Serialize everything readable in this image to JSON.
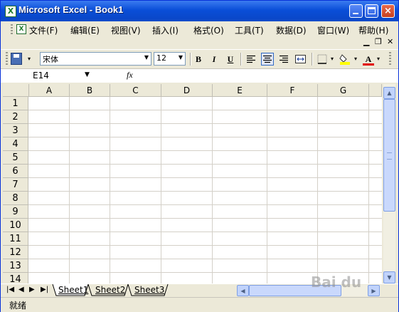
{
  "window": {
    "title": "Microsoft Excel - Book1",
    "app_icon": "excel-icon"
  },
  "menubar": {
    "items": [
      "文件(F)",
      "编辑(E)",
      "视图(V)",
      "插入(I)",
      "格式(O)",
      "工具(T)",
      "数据(D)",
      "窗口(W)",
      "帮助(H)"
    ]
  },
  "toolbar": {
    "font_name": "宋体",
    "font_size": "12",
    "bold": "B",
    "italic": "I",
    "underline": "U",
    "font_color_letter": "A"
  },
  "formula_bar": {
    "cell_ref": "E14",
    "fx": "fx",
    "formula": ""
  },
  "grid": {
    "columns": [
      "A",
      "B",
      "C",
      "D",
      "E",
      "F",
      "G"
    ],
    "rows": [
      "1",
      "2",
      "3",
      "4",
      "5",
      "6",
      "7",
      "8",
      "9",
      "10",
      "11",
      "12",
      "13",
      "14"
    ]
  },
  "sheets": [
    "Sheet1",
    "Sheet2",
    "Sheet3"
  ],
  "status": {
    "text": "就绪"
  },
  "colors": {
    "title_blue": "#0a4ed8",
    "chrome": "#ece9d8",
    "gridline": "#d4d0c8"
  },
  "watermark": "Bai du"
}
